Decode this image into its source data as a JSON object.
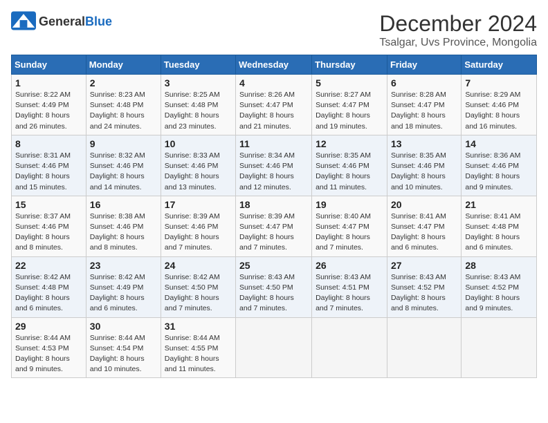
{
  "logo": {
    "general": "General",
    "blue": "Blue"
  },
  "title": "December 2024",
  "subtitle": "Tsalgar, Uvs Province, Mongolia",
  "weekdays": [
    "Sunday",
    "Monday",
    "Tuesday",
    "Wednesday",
    "Thursday",
    "Friday",
    "Saturday"
  ],
  "weeks": [
    [
      {
        "day": "1",
        "sunrise": "Sunrise: 8:22 AM",
        "sunset": "Sunset: 4:49 PM",
        "daylight": "Daylight: 8 hours and 26 minutes."
      },
      {
        "day": "2",
        "sunrise": "Sunrise: 8:23 AM",
        "sunset": "Sunset: 4:48 PM",
        "daylight": "Daylight: 8 hours and 24 minutes."
      },
      {
        "day": "3",
        "sunrise": "Sunrise: 8:25 AM",
        "sunset": "Sunset: 4:48 PM",
        "daylight": "Daylight: 8 hours and 23 minutes."
      },
      {
        "day": "4",
        "sunrise": "Sunrise: 8:26 AM",
        "sunset": "Sunset: 4:47 PM",
        "daylight": "Daylight: 8 hours and 21 minutes."
      },
      {
        "day": "5",
        "sunrise": "Sunrise: 8:27 AM",
        "sunset": "Sunset: 4:47 PM",
        "daylight": "Daylight: 8 hours and 19 minutes."
      },
      {
        "day": "6",
        "sunrise": "Sunrise: 8:28 AM",
        "sunset": "Sunset: 4:47 PM",
        "daylight": "Daylight: 8 hours and 18 minutes."
      },
      {
        "day": "7",
        "sunrise": "Sunrise: 8:29 AM",
        "sunset": "Sunset: 4:46 PM",
        "daylight": "Daylight: 8 hours and 16 minutes."
      }
    ],
    [
      {
        "day": "8",
        "sunrise": "Sunrise: 8:31 AM",
        "sunset": "Sunset: 4:46 PM",
        "daylight": "Daylight: 8 hours and 15 minutes."
      },
      {
        "day": "9",
        "sunrise": "Sunrise: 8:32 AM",
        "sunset": "Sunset: 4:46 PM",
        "daylight": "Daylight: 8 hours and 14 minutes."
      },
      {
        "day": "10",
        "sunrise": "Sunrise: 8:33 AM",
        "sunset": "Sunset: 4:46 PM",
        "daylight": "Daylight: 8 hours and 13 minutes."
      },
      {
        "day": "11",
        "sunrise": "Sunrise: 8:34 AM",
        "sunset": "Sunset: 4:46 PM",
        "daylight": "Daylight: 8 hours and 12 minutes."
      },
      {
        "day": "12",
        "sunrise": "Sunrise: 8:35 AM",
        "sunset": "Sunset: 4:46 PM",
        "daylight": "Daylight: 8 hours and 11 minutes."
      },
      {
        "day": "13",
        "sunrise": "Sunrise: 8:35 AM",
        "sunset": "Sunset: 4:46 PM",
        "daylight": "Daylight: 8 hours and 10 minutes."
      },
      {
        "day": "14",
        "sunrise": "Sunrise: 8:36 AM",
        "sunset": "Sunset: 4:46 PM",
        "daylight": "Daylight: 8 hours and 9 minutes."
      }
    ],
    [
      {
        "day": "15",
        "sunrise": "Sunrise: 8:37 AM",
        "sunset": "Sunset: 4:46 PM",
        "daylight": "Daylight: 8 hours and 8 minutes."
      },
      {
        "day": "16",
        "sunrise": "Sunrise: 8:38 AM",
        "sunset": "Sunset: 4:46 PM",
        "daylight": "Daylight: 8 hours and 8 minutes."
      },
      {
        "day": "17",
        "sunrise": "Sunrise: 8:39 AM",
        "sunset": "Sunset: 4:46 PM",
        "daylight": "Daylight: 8 hours and 7 minutes."
      },
      {
        "day": "18",
        "sunrise": "Sunrise: 8:39 AM",
        "sunset": "Sunset: 4:47 PM",
        "daylight": "Daylight: 8 hours and 7 minutes."
      },
      {
        "day": "19",
        "sunrise": "Sunrise: 8:40 AM",
        "sunset": "Sunset: 4:47 PM",
        "daylight": "Daylight: 8 hours and 7 minutes."
      },
      {
        "day": "20",
        "sunrise": "Sunrise: 8:41 AM",
        "sunset": "Sunset: 4:47 PM",
        "daylight": "Daylight: 8 hours and 6 minutes."
      },
      {
        "day": "21",
        "sunrise": "Sunrise: 8:41 AM",
        "sunset": "Sunset: 4:48 PM",
        "daylight": "Daylight: 8 hours and 6 minutes."
      }
    ],
    [
      {
        "day": "22",
        "sunrise": "Sunrise: 8:42 AM",
        "sunset": "Sunset: 4:48 PM",
        "daylight": "Daylight: 8 hours and 6 minutes."
      },
      {
        "day": "23",
        "sunrise": "Sunrise: 8:42 AM",
        "sunset": "Sunset: 4:49 PM",
        "daylight": "Daylight: 8 hours and 6 minutes."
      },
      {
        "day": "24",
        "sunrise": "Sunrise: 8:42 AM",
        "sunset": "Sunset: 4:50 PM",
        "daylight": "Daylight: 8 hours and 7 minutes."
      },
      {
        "day": "25",
        "sunrise": "Sunrise: 8:43 AM",
        "sunset": "Sunset: 4:50 PM",
        "daylight": "Daylight: 8 hours and 7 minutes."
      },
      {
        "day": "26",
        "sunrise": "Sunrise: 8:43 AM",
        "sunset": "Sunset: 4:51 PM",
        "daylight": "Daylight: 8 hours and 7 minutes."
      },
      {
        "day": "27",
        "sunrise": "Sunrise: 8:43 AM",
        "sunset": "Sunset: 4:52 PM",
        "daylight": "Daylight: 8 hours and 8 minutes."
      },
      {
        "day": "28",
        "sunrise": "Sunrise: 8:43 AM",
        "sunset": "Sunset: 4:52 PM",
        "daylight": "Daylight: 8 hours and 9 minutes."
      }
    ],
    [
      {
        "day": "29",
        "sunrise": "Sunrise: 8:44 AM",
        "sunset": "Sunset: 4:53 PM",
        "daylight": "Daylight: 8 hours and 9 minutes."
      },
      {
        "day": "30",
        "sunrise": "Sunrise: 8:44 AM",
        "sunset": "Sunset: 4:54 PM",
        "daylight": "Daylight: 8 hours and 10 minutes."
      },
      {
        "day": "31",
        "sunrise": "Sunrise: 8:44 AM",
        "sunset": "Sunset: 4:55 PM",
        "daylight": "Daylight: 8 hours and 11 minutes."
      },
      null,
      null,
      null,
      null
    ]
  ]
}
